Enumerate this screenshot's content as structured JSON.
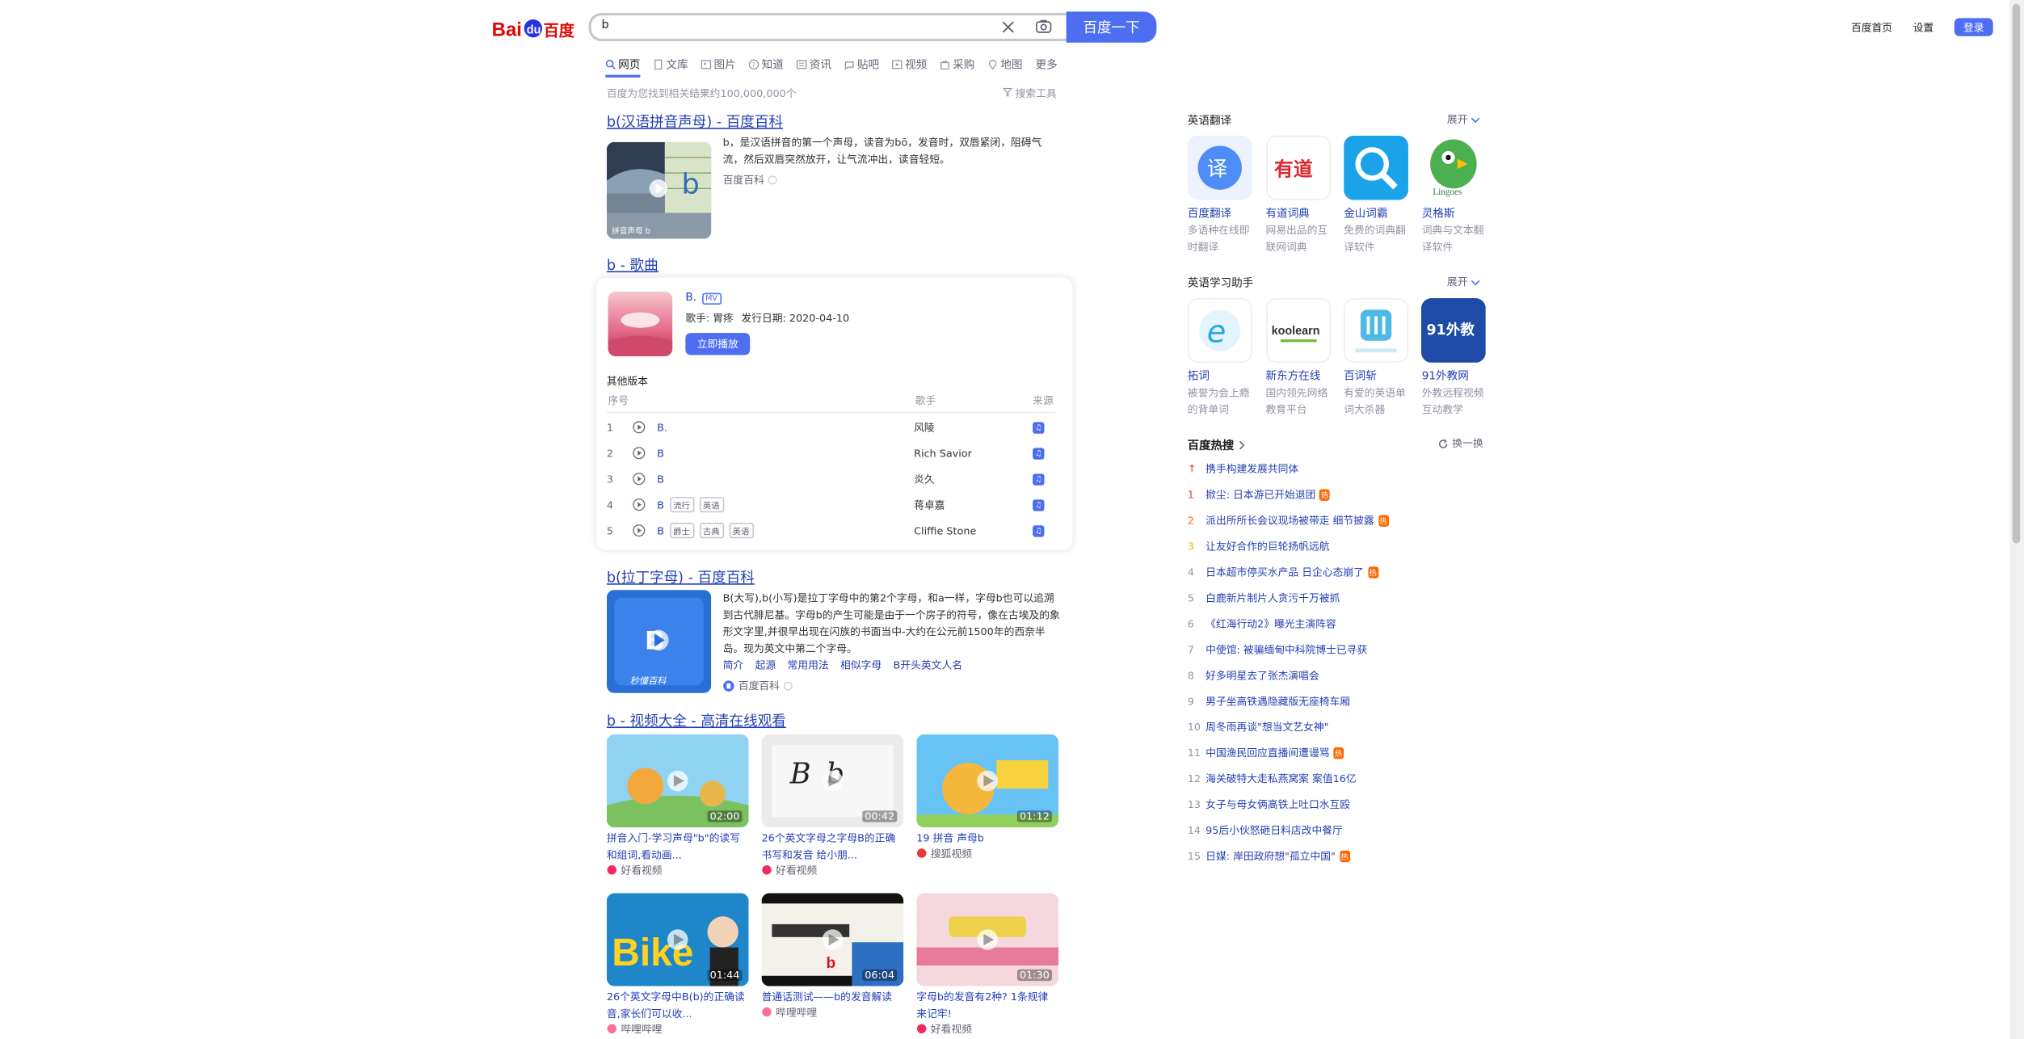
{
  "header": {
    "search_value": "b",
    "search_button": "百度一下",
    "nav_links": [
      "百度首页",
      "设置"
    ],
    "login": "登录"
  },
  "tabs": [
    "网页",
    "文库",
    "图片",
    "知道",
    "资讯",
    "贴吧",
    "视频",
    "采购",
    "地图",
    "更多"
  ],
  "results_meta": {
    "count": "百度为您找到相关结果约100,000,000个",
    "tools": "搜索工具"
  },
  "result1": {
    "title": "b(汉语拼音声母) - 百度百科",
    "snippet": "b，是汉语拼音的第一个声母，读音为bō，发音时，双唇紧闭，阻碍气流，然后双唇突然放开，让气流冲出，读音轻短。",
    "source": "百度百科",
    "thumb_text": "拼音声母 b"
  },
  "result2": {
    "title": "b - 歌曲",
    "song": "B.",
    "badge": "MV",
    "singer": "歌手: 胃疼",
    "release": "发行日期: 2020-04-10",
    "play": "立即播放",
    "other_versions": "其他版本",
    "headers": [
      "序号",
      "歌手",
      "来源"
    ],
    "rows": [
      {
        "no": "1",
        "song": "B.",
        "singer": "风陵",
        "tags": []
      },
      {
        "no": "2",
        "song": "B",
        "singer": "Rich Savior",
        "tags": []
      },
      {
        "no": "3",
        "song": "B",
        "singer": "炎久",
        "tags": []
      },
      {
        "no": "4",
        "song": "B",
        "singer": "蒋卓嘉",
        "tags": [
          "流行",
          "英语"
        ]
      },
      {
        "no": "5",
        "song": "B",
        "singer": "Cliffie Stone",
        "tags": [
          "爵士",
          "古典",
          "英语"
        ]
      }
    ]
  },
  "result3": {
    "title": "b(拉丁字母) - 百度百科",
    "snippet": "B(大写),b(小写)是拉丁字母中的第2个字母，和a一样，字母b也可以追溯到古代腓尼基。字母b的产生可能是由于一个房子的符号，像在古埃及的象形文字里,并很早出现在闪族的书面当中-大约在公元前1500年的西奈半岛。现为英文中第二个字母。",
    "links": [
      "简介",
      "起源",
      "常用用法",
      "相似字母",
      "B开头英文人名"
    ],
    "source": "百度百科",
    "thumb_text": "秒懂百科"
  },
  "result4": {
    "title": "b - 视频大全 - 高清在线观看",
    "videos": [
      {
        "title": "拼音入门-学习声母\"b\"的读写和组词,看动画...",
        "duration": "02:00",
        "source": "好看视频"
      },
      {
        "title": "26个英文字母之字母B的正确书写和发音 给小朋...",
        "duration": "00:42",
        "source": "好看视频"
      },
      {
        "title": "19 拼音 声母b",
        "duration": "01:12",
        "source": "搜狐视频"
      },
      {
        "title": "26个英文字母中B(b)的正确读音,家长们可以收...",
        "duration": "01:44",
        "source": "哔哩哔哩"
      },
      {
        "title": "普通话测试——b的发音解读",
        "duration": "06:04",
        "source": "哔哩哔哩"
      },
      {
        "title": "字母b的发音有2种? 1条规律来记牢!",
        "duration": "01:30",
        "source": "好看视频"
      }
    ]
  },
  "sidebar": {
    "translate_title": "英语翻译",
    "expand": "展开",
    "translate_apps": [
      {
        "name": "百度翻译",
        "desc": "多语种在线即时翻译",
        "icon": "译"
      },
      {
        "name": "有道词典",
        "desc": "网易出品的互联网词典",
        "icon": "有道"
      },
      {
        "name": "金山词霸",
        "desc": "免费的词典翻译软件",
        "icon": "search"
      },
      {
        "name": "灵格斯",
        "desc": "词典与文本翻译软件",
        "icon": "Lingoes"
      }
    ],
    "learn_title": "英语学习助手",
    "learn_apps": [
      {
        "name": "拓词",
        "desc": "被誉为会上瘾的背单词",
        "icon": "e"
      },
      {
        "name": "新东方在线",
        "desc": "国内领先网络教育平台",
        "icon": "koolearn"
      },
      {
        "name": "百词斩",
        "desc": "有爱的英语单词大杀器",
        "icon": "百"
      },
      {
        "name": "91外教网",
        "desc": "外教远程视频互动教学",
        "icon": "91外教"
      }
    ],
    "hot_title": "百度热搜",
    "hot_refresh": "换一换",
    "hot_items": [
      {
        "no": "↑",
        "text": "携手构建发展共同体",
        "hot": false
      },
      {
        "no": "1",
        "text": "掀尘: 日本游已开始退团",
        "hot": true
      },
      {
        "no": "2",
        "text": "派出所所长会议现场被带走 细节披露",
        "hot": true
      },
      {
        "no": "3",
        "text": "让友好合作的巨轮扬帆远航",
        "hot": false
      },
      {
        "no": "4",
        "text": "日本超市停买水产品 日企心态崩了",
        "hot": true
      },
      {
        "no": "5",
        "text": "白鹿新片制片人贪污千万被抓",
        "hot": false
      },
      {
        "no": "6",
        "text": "《红海行动2》曝光主演阵容",
        "hot": false
      },
      {
        "no": "7",
        "text": "中使馆: 被骗缅甸中科院博士已寻获",
        "hot": false
      },
      {
        "no": "8",
        "text": "好多明星去了张杰演唱会",
        "hot": false
      },
      {
        "no": "9",
        "text": "男子坐高铁遇隐藏版无座椅车厢",
        "hot": false
      },
      {
        "no": "10",
        "text": "周冬雨再谈\"想当文艺女神\"",
        "hot": false
      },
      {
        "no": "11",
        "text": "中国渔民回应直播间遭谩骂",
        "hot": true
      },
      {
        "no": "12",
        "text": "海关破特大走私燕窝案 案值16亿",
        "hot": false
      },
      {
        "no": "13",
        "text": "女子与母女俩高铁上吐口水互殴",
        "hot": false
      },
      {
        "no": "14",
        "text": "95后小伙怒砸日料店改中餐厅",
        "hot": false
      },
      {
        "no": "15",
        "text": "日媒: 岸田政府想\"孤立中国\"",
        "hot": true
      }
    ]
  }
}
